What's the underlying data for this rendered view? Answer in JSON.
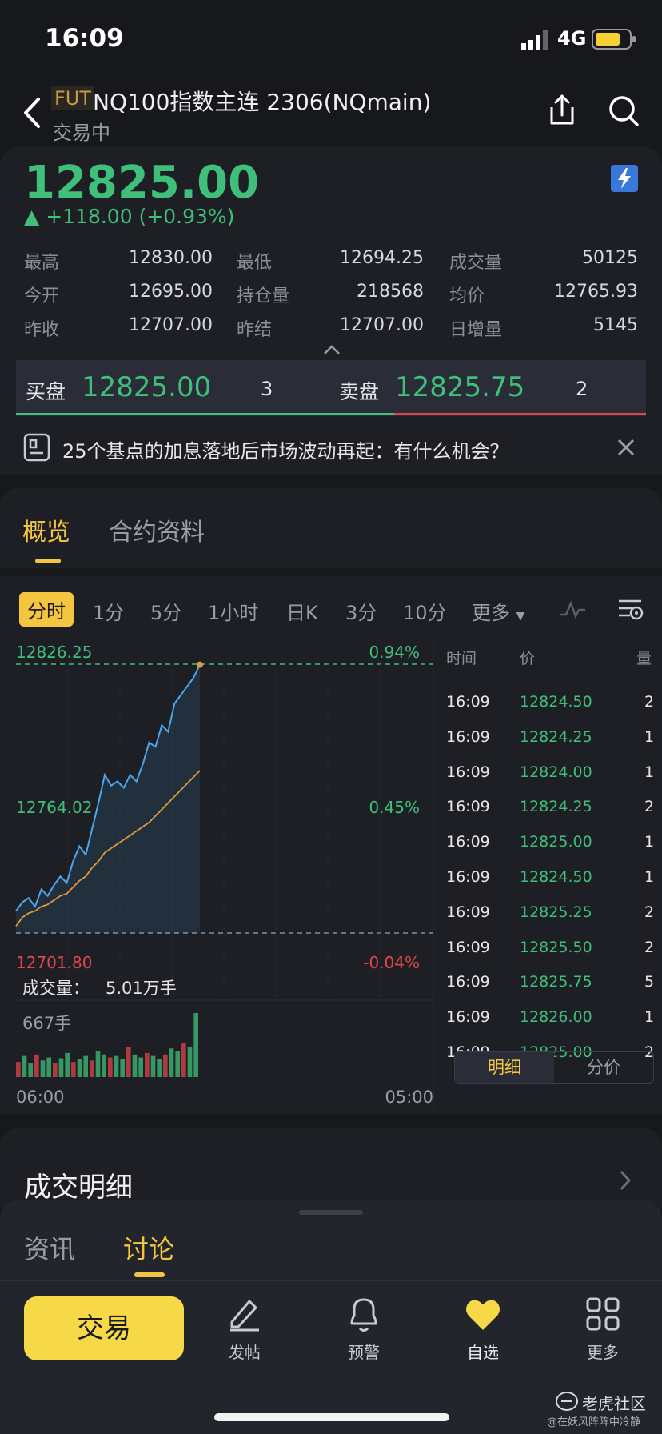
{
  "status_bar": {
    "time": "16:09",
    "network": "4G"
  },
  "header": {
    "badge": "FUT",
    "title": "NQ100指数主连 2306(NQmain)",
    "status": "交易中"
  },
  "quote": {
    "price": "12825.00",
    "change": "+118.00 (+0.93%)",
    "stats": [
      {
        "label": "最高",
        "value": "12830.00"
      },
      {
        "label": "最低",
        "value": "12694.25"
      },
      {
        "label": "成交量",
        "value": "50125"
      },
      {
        "label": "今开",
        "value": "12695.00"
      },
      {
        "label": "持仓量",
        "value": "218568"
      },
      {
        "label": "均价",
        "value": "12765.93"
      },
      {
        "label": "昨收",
        "value": "12707.00"
      },
      {
        "label": "昨结",
        "value": "12707.00"
      },
      {
        "label": "日增量",
        "value": "5145"
      }
    ],
    "bid": {
      "label": "买盘",
      "price": "12825.00",
      "qty": "3"
    },
    "ask": {
      "label": "卖盘",
      "price": "12825.75",
      "qty": "2"
    }
  },
  "news": {
    "text": "25个基点的加息落地后市场波动再起：有什么机会？"
  },
  "section_tabs": {
    "overview": "概览",
    "contract": "合约资料"
  },
  "periods": [
    "分时",
    "1分",
    "5分",
    "1小时",
    "日K",
    "3分",
    "10分",
    "更多"
  ],
  "chart_data": {
    "type": "line",
    "title": "",
    "y_top_price": "12826.25",
    "y_top_pct": "0.94%",
    "y_mid_price": "12764.02",
    "y_mid_pct": "0.45%",
    "y_bot_price": "12701.80",
    "y_bot_pct": "-0.04%",
    "x_start": "06:00",
    "x_end": "05:00",
    "ylim": [
      12701.8,
      12826.25
    ],
    "series": [
      {
        "values": [
          12712,
          12716,
          12718,
          12714,
          12722,
          12719,
          12724,
          12728,
          12725,
          12735,
          12742,
          12738,
          12750,
          12762,
          12775,
          12770,
          12772,
          12769,
          12775,
          12772,
          12780,
          12790,
          12788,
          12798,
          12795,
          12808,
          12812,
          12816,
          12820,
          12826
        ]
      },
      {
        "values": [
          12705,
          12709,
          12711,
          12712,
          12714,
          12715,
          12717,
          12719,
          12720,
          12723,
          12726,
          12728,
          12732,
          12735,
          12739,
          12741,
          12743,
          12745,
          12747,
          12749,
          12751,
          12753,
          12756,
          12759,
          12762,
          12765,
          12768,
          12771,
          12774,
          12777
        ]
      }
    ],
    "volume_label": "成交量：",
    "volume_value": "5.01万手",
    "volume_scale": "667手",
    "volume_bars": [
      20,
      28,
      18,
      30,
      22,
      26,
      18,
      25,
      32,
      20,
      24,
      28,
      22,
      35,
      30,
      26,
      28,
      24,
      40,
      30,
      26,
      32,
      28,
      24,
      30,
      38,
      34,
      45,
      40,
      85
    ]
  },
  "ticks": {
    "headers": {
      "time": "时间",
      "price": "价",
      "qty": "量"
    },
    "rows": [
      {
        "time": "16:09",
        "price": "12824.50",
        "qty": "2"
      },
      {
        "time": "16:09",
        "price": "12824.25",
        "qty": "1"
      },
      {
        "time": "16:09",
        "price": "12824.00",
        "qty": "1"
      },
      {
        "time": "16:09",
        "price": "12824.25",
        "qty": "2"
      },
      {
        "time": "16:09",
        "price": "12825.00",
        "qty": "1"
      },
      {
        "time": "16:09",
        "price": "12824.50",
        "qty": "1"
      },
      {
        "time": "16:09",
        "price": "12825.25",
        "qty": "2"
      },
      {
        "time": "16:09",
        "price": "12825.50",
        "qty": "2"
      },
      {
        "time": "16:09",
        "price": "12825.75",
        "qty": "5"
      },
      {
        "time": "16:09",
        "price": "12826.00",
        "qty": "1"
      },
      {
        "time": "16:09",
        "price": "12825.00",
        "qty": "2"
      }
    ],
    "toggle_detail": "明细",
    "toggle_price": "分价"
  },
  "trade_detail": {
    "title": "成交明细"
  },
  "sheet_tabs": {
    "news": "资讯",
    "discussion": "讨论"
  },
  "bottom_nav": {
    "trade": "交易",
    "post": "发帖",
    "alert": "预警",
    "watchlist": "自选",
    "more": "更多"
  },
  "watermark": {
    "brand": "老虎社区",
    "user": "@在妖风阵阵中冷静"
  },
  "colors": {
    "up": "#3fbf7a",
    "down": "#e0464b",
    "accent": "#f4c640",
    "line": "#4aa8f0",
    "avg": "#e8973a"
  }
}
